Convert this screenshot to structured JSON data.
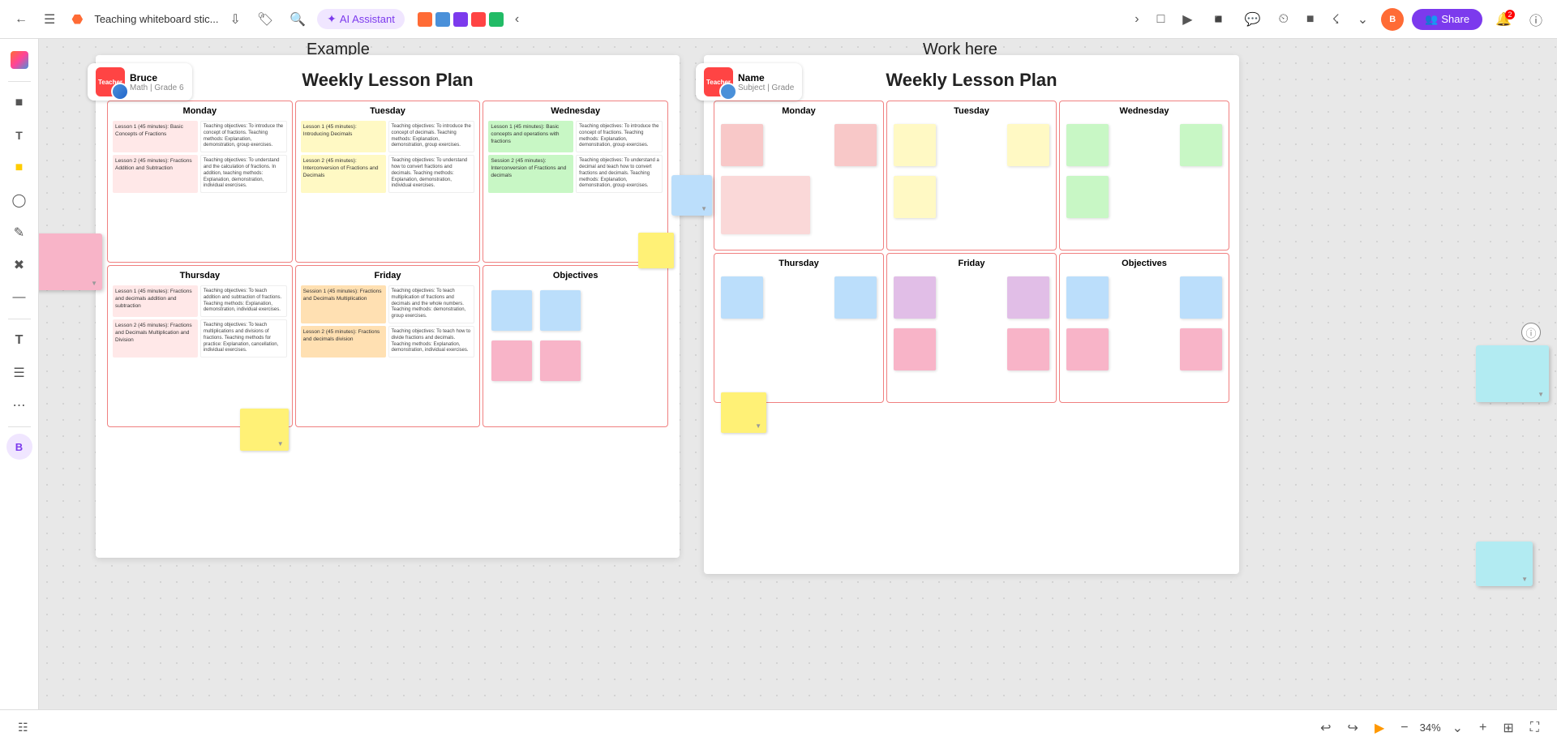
{
  "toolbar": {
    "back_icon": "←",
    "menu_icon": "☰",
    "logo_icon": "⬡",
    "title": "Teaching whiteboard stic...",
    "download_icon": "⬇",
    "tag_icon": "🏷",
    "search_icon": "🔍",
    "ai_label": "AI Assistant",
    "share_label": "Share",
    "chevron_right": "›",
    "user_initials": "B",
    "tools": [
      "◁",
      "▷",
      "📋",
      "⚡",
      "💬",
      "🕒",
      "📐",
      "⊞",
      "≡",
      "⌨"
    ]
  },
  "sidebar": {
    "icons": [
      "◉",
      "⬜",
      "T",
      "◆",
      "✎",
      "✂",
      "─",
      "T",
      "≡",
      "•••",
      "🎨"
    ]
  },
  "canvas": {
    "example_label": "Example",
    "work_label": "Work here",
    "example_panel": {
      "title": "Weekly Lesson Plan",
      "teacher_badge": {
        "role": "Teacher",
        "name": "Bruce",
        "subject": "Math | Grade 6"
      },
      "days": {
        "monday": {
          "label": "Monday",
          "lesson1_title": "Lesson 1 (45 minutes): Basic Concepts of Fractions",
          "lesson1_obj": "Teaching objectives: To introduce the concept of fractions. Teaching methods: Explanation, demonstration, group exercises.",
          "lesson2_title": "Lesson 2 (45 minutes): Fractions Addition and Subtraction",
          "lesson2_obj": "Teaching objectives: To understand the calculation of fractions. In addition, teaching methods: Explanation, demonstration, individual exercises."
        },
        "tuesday": {
          "label": "Tuesday",
          "lesson1_title": "Lesson 1 (45 minutes): Introducing Decimals",
          "lesson1_obj": "Teaching objectives: To introduce the concept of decimals. Teaching methods: Explanation, demonstration, group exercises.",
          "lesson2_title": "Lesson 2 (45 minutes): Interconversion of Fractions and Decimals",
          "lesson2_obj": "Teaching objectives: To understand how to convert fractions and decimals. Teaching methods: Explanation, demonstration, individual exercises."
        },
        "wednesday": {
          "label": "Wednesday",
          "lesson1_title": "Lesson 1 (45 minutes): Basic concepts and operations with fractions",
          "lesson1_obj": "Teaching objectives: To introduce the concept of fractions. Teaching methods: Explanation, demonstration, group exercises.",
          "lesson2_title": "Session 2 (45 minutes): Interconversion of Fractions and decimals",
          "lesson2_obj": "Teaching objectives: To understand a decimal and teach how to convert fractions and decimals. Teaching methods: Explanation, demonstration, group exercises."
        },
        "thursday": {
          "label": "Thursday",
          "lesson1_title": "Lesson 1 (45 minutes): Fractions and decimals addition and subtraction",
          "lesson1_obj": "Teaching objectives: To teach addition and subtraction of fractions. Teaching methods: Explanation, demonstration, individual exercises.",
          "lesson2_title": "Lesson 2 (45 minutes): Fractions and Decimals Multiplication and Division",
          "lesson2_obj": "Teaching objectives: To teach multiplications and divisions of fractions. Teaching methods for practice: Explanation, cancellation, individual exercises."
        },
        "friday": {
          "label": "Friday",
          "lesson1_title": "Session 1 (45 minutes): Fractions and Decimals Multiplication",
          "lesson1_obj": "Teaching objectives: To teach multiplication of fractions and decimals and the whole numbers. Teaching methods: demonstration, group exercises.",
          "lesson2_title": "Lesson 2 (45 minutes): Fractions and decimals division",
          "lesson2_obj": "Teaching objectives: To teach how to divide fractions and decimals. Teaching methods: Explanation, demonstration, individual exercises."
        },
        "objectives": {
          "label": "Objectives"
        }
      }
    },
    "work_panel": {
      "title": "Weekly Lesson Plan",
      "teacher_badge": {
        "role": "Teacher",
        "name": "Name",
        "subject": "Subject | Grade"
      },
      "days": {
        "monday": {
          "label": "Monday"
        },
        "tuesday": {
          "label": "Tuesday"
        },
        "wednesday": {
          "label": "Wednesday"
        },
        "thursday": {
          "label": "Thursday"
        },
        "friday": {
          "label": "Friday"
        },
        "objectives": {
          "label": "Objectives"
        }
      }
    }
  },
  "bottom": {
    "map_icon": "⊞",
    "undo_icon": "↩",
    "redo_icon": "↪",
    "pointer_icon": "▶",
    "zoom_out_icon": "−",
    "zoom_level": "34%",
    "zoom_in_icon": "+",
    "fit_icon": "⊡",
    "fullscreen_icon": "⛶"
  },
  "colors": {
    "pink_light": "#ffe0e0",
    "pink_medium": "#ffb3b3",
    "yellow_light": "#fff9c4",
    "yellow_medium": "#fff176",
    "green_light": "#c8f7c5",
    "blue_light": "#bbdefb",
    "purple_light": "#e1bee7",
    "orange_light": "#ffe0b2",
    "teal_light": "#b2ebf2",
    "accent_purple": "#7c3aed",
    "red_border": "#f08080"
  }
}
